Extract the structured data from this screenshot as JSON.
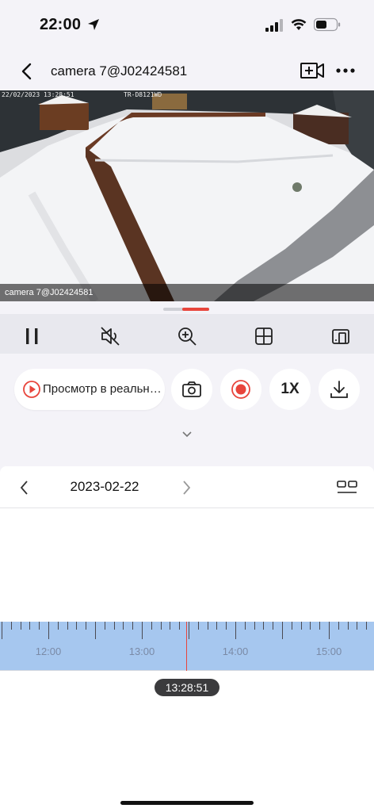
{
  "status_bar": {
    "time": "22:00",
    "icons": [
      "location-arrow-icon",
      "signal-icon",
      "wifi-icon",
      "battery-icon"
    ]
  },
  "header": {
    "title": "camera 7@J02424581",
    "icons": [
      "back-icon",
      "add-camera-icon",
      "more-icon"
    ]
  },
  "video": {
    "overlay_label": "camera 7@J02424581",
    "osd_timestamp": "22/02/2023 13:28:51",
    "osd_camera": "TR-D8121WD"
  },
  "controls": {
    "icons": [
      "pause-icon",
      "mute-icon",
      "zoom-in-icon",
      "grid-view-icon",
      "device-switch-icon"
    ]
  },
  "actions": {
    "live_label": "Просмотр в реальном времени",
    "speed_label": "1X",
    "icons": [
      "play-circle-icon",
      "camera-snapshot-icon",
      "record-icon",
      "download-icon",
      "chevron-down-icon"
    ]
  },
  "date_nav": {
    "date": "2023-02-22",
    "icons": [
      "chevron-left-icon",
      "chevron-right-icon",
      "layout-toggle-icon"
    ]
  },
  "timeline": {
    "hour_labels": [
      "12:00",
      "13:00",
      "14:00",
      "15:00"
    ],
    "current_time": "13:28:51"
  },
  "colors": {
    "accent": "#e8453c",
    "timeline_fill": "#a6c7ef",
    "control_bar": "#e8e8ee"
  }
}
